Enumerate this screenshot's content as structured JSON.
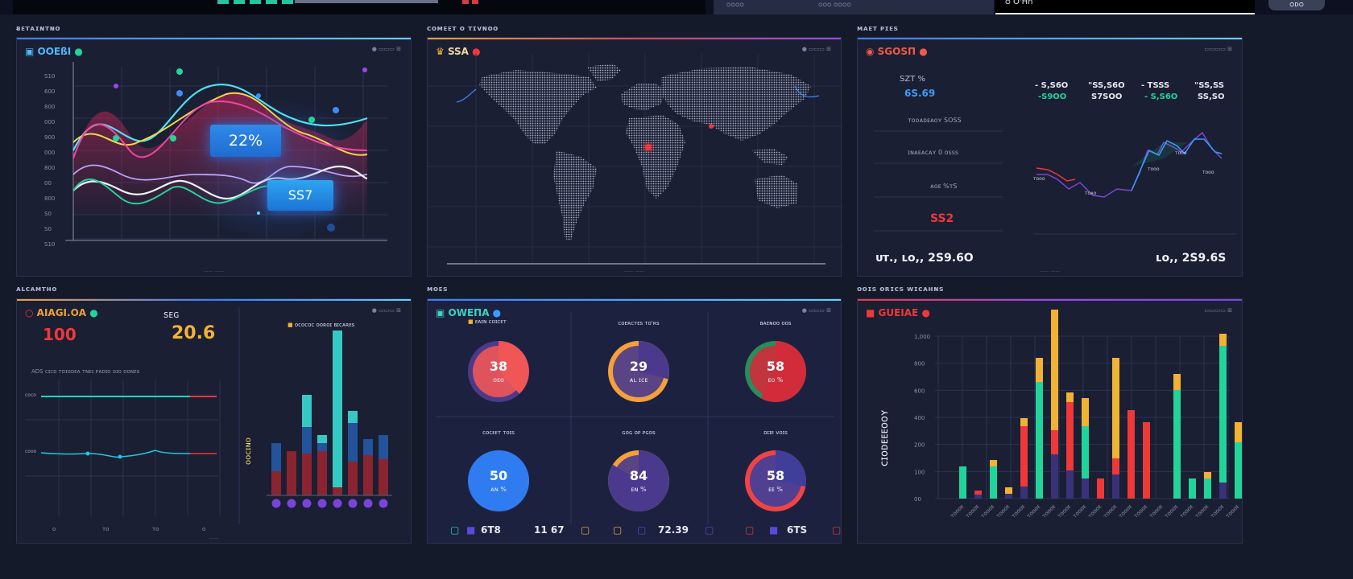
{
  "header": {
    "search_label": "ᴑ O'Hn",
    "button_label": "ᴑᴅᴑ",
    "center_left": "ᴑᴑᴑᴑ",
    "center_right": "ᴑᴑᴑ ᴑᴑᴑᴑ"
  },
  "sections": {
    "top_left": "ᴃᴇᴛᴀɪɴᴛɴᴏ",
    "top_mid": "ᴄᴏᴍᴇᴇᴛ ᴏ ᴛɪᴠɴᴏᴏ",
    "top_right": "ᴍᴀᴇᴛ ᴘɪᴇs",
    "bot_left": "ᴀʟᴄᴀᴍᴛʜᴏ",
    "bot_mid": "ᴍᴏᴇs",
    "bot_right": "ᴏᴏɪs ᴏʀɪᴄs ᴡɪᴄᴀʜɴs"
  },
  "panel_line": {
    "title": "OOEßI",
    "badge_1": "22%",
    "badge_2": "SS7",
    "y_ticks": [
      "S10",
      "600",
      "800",
      "000",
      "900",
      "000",
      "800",
      "00",
      "800",
      "S0",
      "S0",
      "S10"
    ]
  },
  "panel_map": {
    "title": "SSA"
  },
  "panel_stats": {
    "title": "SGOSΠ",
    "stat_label": "SZT %",
    "stat_value": "6S.69",
    "rows": [
      "ᴛᴏᴏᴀᴅᴇᴀᴏʏ SOSS",
      "ɪɴᴀᴇᴀᴄᴀʏ 0 ᴏsss",
      "ᴀᴏᴇ %ᴛS"
    ],
    "alert_value": "SS2",
    "cols": [
      {
        "top": "- S,S6O",
        "bottom": "-S9OO"
      },
      {
        "top": "\"SS,S6O",
        "bottom": "S7SOO"
      },
      {
        "top": "- TSSS",
        "bottom": "- S,S6O"
      },
      {
        "top": "\"SS,SS",
        "bottom": "SS,SO"
      }
    ],
    "spark_labels": [
      "ᴛᴏᴏᴏ",
      "ᴛᴏᴀᴏ",
      "ᴛᴏᴏᴏ",
      "ᴛᴏᴏᴏ",
      "ᴛᴏᴏᴏ"
    ],
    "bottom_left": "ᴜᴛ., ʟᴏ,, 2S9.6O",
    "bottom_right": "ʟᴏ,, 2S9.6S"
  },
  "panel_alert": {
    "title": "AIAGI.ΟA",
    "value_1": "100",
    "value_2": "20.6",
    "value_2_label": "sᴇɢ",
    "row_label": "ADS  ᴄɪᴄᴅ ᴛᴏɪᴏᴅᴇᴀ ᴛɴᴇɪ ᴘᴀᴅɪᴏ  ᴅɪᴏ ᴏᴏɴᴇs",
    "line_labels": [
      "ᴄᴏᴄᴏ",
      "ᴄᴏᴏᴏ"
    ],
    "x_ticks": [
      "ᴏ",
      "ᴛᴏ",
      "ᴛᴏ",
      "ᴏ"
    ],
    "bar_legend": "ᴏᴄᴏᴄᴏᴄ ᴏᴏʀᴏɪ ʙɪᴄᴀʀᴇs",
    "bar_axis": "ᴏᴏᴄɪɴᴏ",
    "bars": [
      {
        "red": 30,
        "blue": 65,
        "cyan": 0
      },
      {
        "red": 55,
        "blue": 0,
        "cyan": 0
      },
      {
        "red": 52,
        "blue": 85,
        "cyan": 125
      },
      {
        "red": 55,
        "blue": 65,
        "cyan": 75
      },
      {
        "red": 10,
        "blue": 0,
        "cyan": 195
      },
      {
        "red": 42,
        "blue": 90,
        "cyan": 105
      },
      {
        "red": 50,
        "blue": 70,
        "cyan": 0
      },
      {
        "red": 45,
        "blue": 75,
        "cyan": 0
      }
    ]
  },
  "panel_gauges": {
    "title": "OWEΠA",
    "legend": "ᴇᴀɪɴ ᴄᴏɪᴄᴇᴛ",
    "gauges": [
      {
        "value": "38",
        "sub": "ᴏᴇᴏ",
        "label": "",
        "pct": 0.38,
        "fill": "#f05656",
        "track": "#4b3a8a"
      },
      {
        "value": "29",
        "sub": "ᴀʟ ɪᴄᴇ",
        "label": "ᴄᴏᴇʀᴄᴛᴇs ᴛᴏ'ʀs",
        "pct": 0.29,
        "fill": "#4a3a8c",
        "track": "#f5a03a"
      },
      {
        "value": "58",
        "sub": "ᴇᴏ %",
        "label": "ʙᴀᴇɴᴏᴏ ᴏᴏs",
        "pct": 0.58,
        "fill": "#d22b3a",
        "track": "#2b8c5a"
      },
      {
        "value": "50",
        "sub": "ᴀɴ %",
        "label": "ᴄᴏᴄᴇᴇᴛ ᴛᴏɪs",
        "pct": 0.5,
        "fill": "#2f7cf0",
        "track": "#2f7cf0"
      },
      {
        "value": "84",
        "sub": "ᴇɴ %",
        "label": "ɢᴏɢ ᴏᴘ ᴘɢᴅs",
        "pct": 0.84,
        "fill": "#4a3a8c",
        "track": "#f5a03a"
      },
      {
        "value": "58",
        "sub": "ᴇᴇ %",
        "label": "ᴅɪɪᴇ ᴠᴏɪs",
        "pct": 0.28,
        "fill": "#3f3f9a",
        "track": "#f04444"
      }
    ],
    "footer": [
      "6T8",
      "11 67",
      "72.39",
      "6TS"
    ]
  },
  "panel_stack": {
    "title": "GUEIAE",
    "y_axis": "ᴄɪᴏᴅᴇᴇᴇᴏᴏʏ",
    "y_ticks": [
      "1,000",
      "800",
      "600",
      "400",
      "200",
      "100",
      "00"
    ],
    "colors": {
      "green": "#22d49a",
      "red": "#ef3838",
      "yellow": "#f2b233",
      "purple": "#3a3278"
    },
    "bars": [
      {
        "green": 40,
        "red": 0,
        "yellow": 0,
        "purple": 0
      },
      {
        "green": 0,
        "red": 5,
        "yellow": 0,
        "purple": 5
      },
      {
        "green": 40,
        "red": 0,
        "yellow": 8,
        "purple": 0
      },
      {
        "green": 0,
        "red": 0,
        "yellow": 8,
        "purple": 6
      },
      {
        "green": 0,
        "red": 75,
        "yellow": 10,
        "purple": 15
      },
      {
        "green": 145,
        "red": 0,
        "yellow": 30,
        "purple": 0
      },
      {
        "green": 0,
        "red": 30,
        "yellow": 150,
        "purple": 55
      },
      {
        "green": 0,
        "red": 85,
        "yellow": 12,
        "purple": 35
      },
      {
        "green": 65,
        "red": 0,
        "yellow": 35,
        "purple": 25
      },
      {
        "green": 0,
        "red": 25,
        "yellow": 0,
        "purple": 0
      },
      {
        "green": 0,
        "red": 20,
        "yellow": 125,
        "purple": 30
      },
      {
        "green": 0,
        "red": 110,
        "yellow": 0,
        "purple": 0
      },
      {
        "green": 0,
        "red": 95,
        "yellow": 0,
        "purple": 0
      },
      {
        "green": 0,
        "red": 0,
        "yellow": 0,
        "purple": 0
      },
      {
        "green": 135,
        "red": 0,
        "yellow": 20,
        "purple": 0
      },
      {
        "green": 25,
        "red": 0,
        "yellow": 0,
        "purple": 0
      },
      {
        "green": 25,
        "red": 0,
        "yellow": 8,
        "purple": 0
      },
      {
        "green": 170,
        "red": 0,
        "yellow": 15,
        "purple": 20
      },
      {
        "green": 70,
        "red": 0,
        "yellow": 25,
        "purple": 0
      }
    ]
  }
}
